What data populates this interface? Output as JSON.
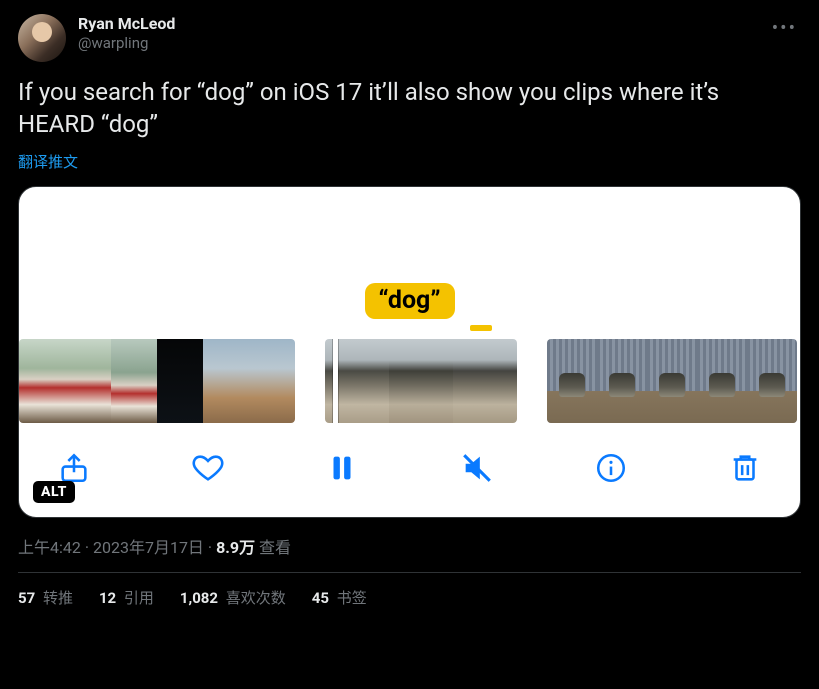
{
  "author": {
    "display_name": "Ryan McLeod",
    "handle": "@warpling"
  },
  "body": "If you search for “dog” on iOS 17 it’ll also show you clips where it’s HEARD “dog”",
  "translate_label": "翻译推文",
  "media": {
    "caption_chip": "“dog”",
    "alt_badge": "ALT"
  },
  "meta": {
    "time": "上午4:42",
    "date": "2023年7月17日",
    "views_number": "8.9万",
    "views_label": " 查看"
  },
  "stats": {
    "retweets_n": "57",
    "retweets_label": " 转推",
    "quotes_n": "12",
    "quotes_label": " 引用",
    "likes_n": "1,082",
    "likes_label": " 喜欢次数",
    "bookmarks_n": "45",
    "bookmarks_label": " 书签"
  }
}
